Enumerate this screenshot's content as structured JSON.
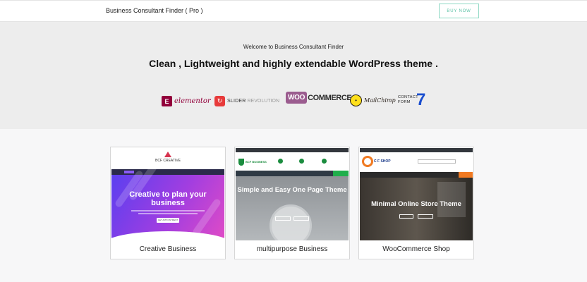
{
  "header": {
    "brand": "Business Consultant Finder ( Pro )",
    "buy_label": "BUY NOW"
  },
  "hero": {
    "welcome": "Welcome to Business Consultant Finder",
    "tagline": "Clean , Lightweight and highly extendable WordPress theme ."
  },
  "logos": {
    "elementor": {
      "mark": "E",
      "name": "elementor"
    },
    "slider": {
      "name": "SLIDER",
      "name2": "REVOLUTION"
    },
    "woo": {
      "mark": "WOO",
      "name": "COMMERCE"
    },
    "mailchimp": {
      "name": "MailChimp"
    },
    "cf7": {
      "line1": "CONTACT",
      "line2": "FORM",
      "digit": "7"
    }
  },
  "cards": [
    {
      "title": "Creative Business",
      "thumb_logo": "BCF CREATIVE",
      "thumb_title": "Creative to plan your business",
      "thumb_button": "GET APPOINTMENT"
    },
    {
      "title": "multipurpose Business",
      "thumb_logo": "BCF BUSINESS",
      "thumb_title": "Simple and Easy One Page Theme"
    },
    {
      "title": "WooCommerce Shop",
      "thumb_logo": "C F SHOP",
      "thumb_title": "Minimal Online Store Theme"
    }
  ],
  "colors": {
    "accent": "#5cc2a6",
    "hero_bg": "#ededed"
  }
}
